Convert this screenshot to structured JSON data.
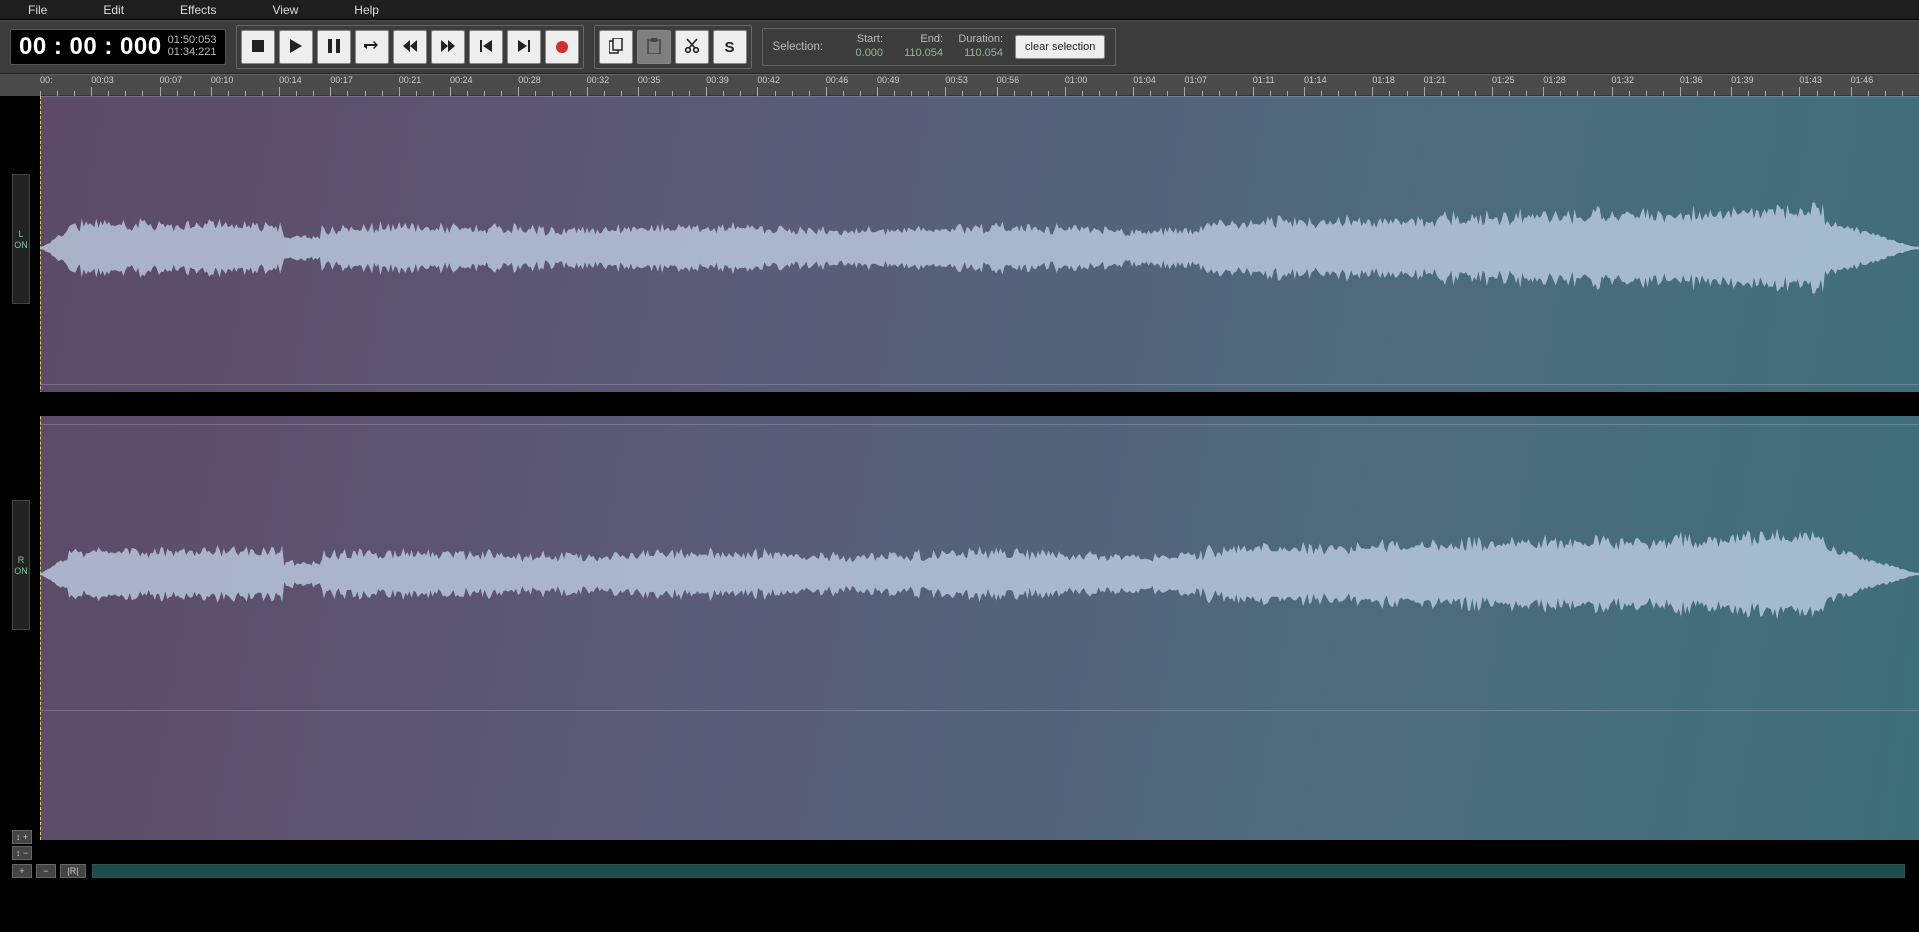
{
  "menu": {
    "items": [
      "File",
      "Edit",
      "Effects",
      "View",
      "Help"
    ]
  },
  "time": {
    "position": "00 : 00 : 000",
    "line1": "01:50:053",
    "line2": "01:34:221"
  },
  "transport": {
    "stop": "stop",
    "play": "play",
    "pause": "pause",
    "loop": "loop",
    "rewind": "rewind",
    "forward": "forward",
    "to_start": "skip-start",
    "to_end": "skip-end",
    "record": "record"
  },
  "edit": {
    "copy": "copy",
    "paste": "paste",
    "cut": "cut",
    "script": "S"
  },
  "selection": {
    "label": "Selection:",
    "start_h": "Start:",
    "start_v": "0.000",
    "end_h": "End:",
    "end_v": "110.054",
    "dur_h": "Duration:",
    "dur_v": "110.054",
    "clear": "clear selection"
  },
  "ruler": {
    "first_label": "00:"
  },
  "channels": {
    "left": {
      "ch": "L",
      "on": "ON"
    },
    "right": {
      "ch": "R",
      "on": "ON"
    }
  },
  "zoom": {
    "vplus": "↕ +",
    "vminus": "↕ −",
    "plus": "+",
    "minus": "−",
    "reset": "|R|"
  }
}
